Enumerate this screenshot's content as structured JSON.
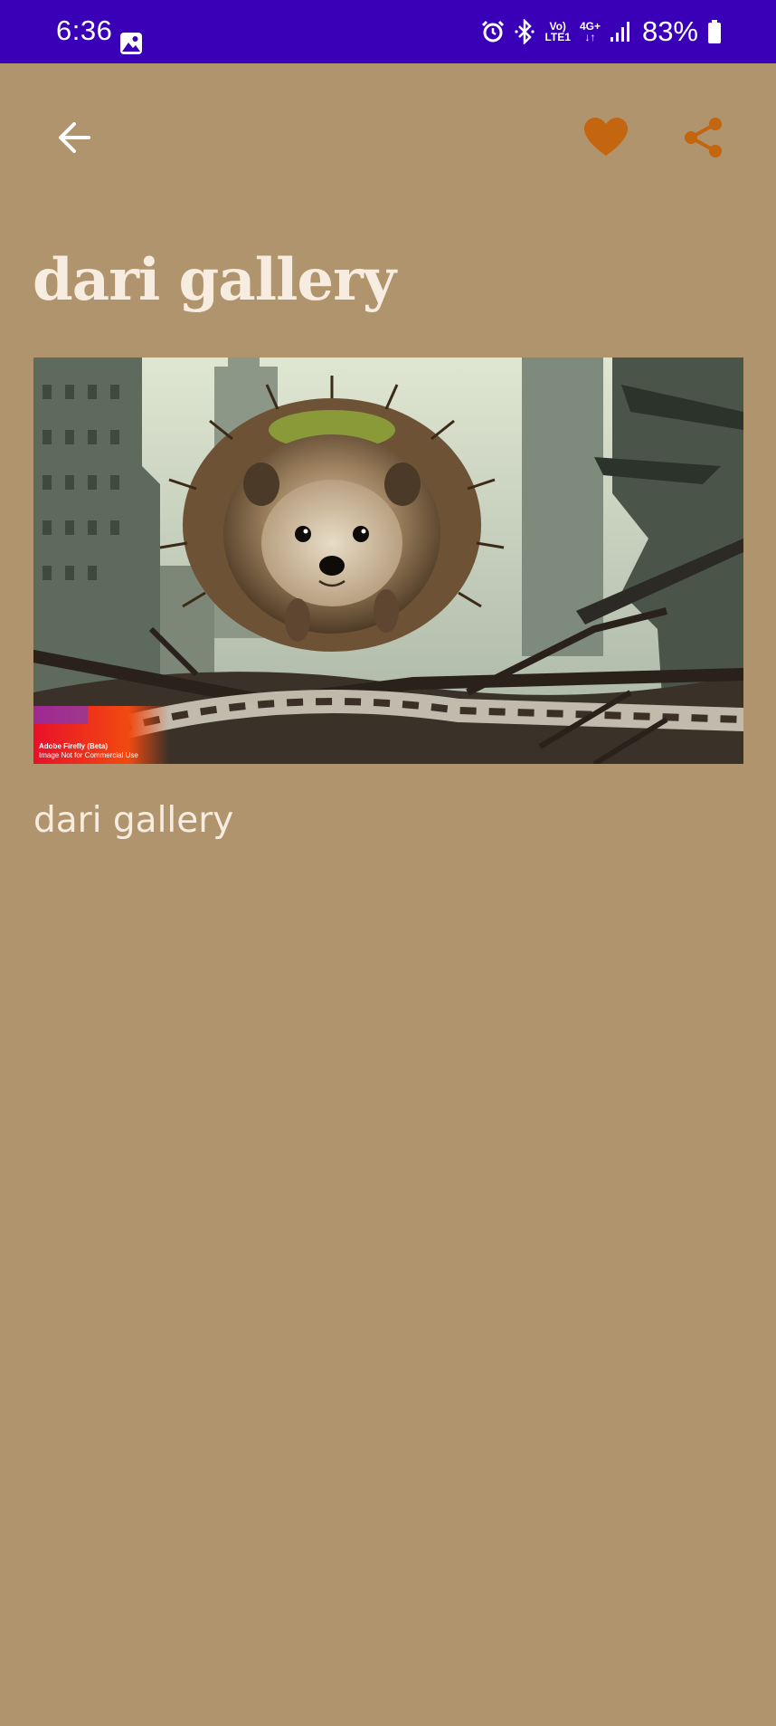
{
  "status_bar": {
    "time": "6:36",
    "network_top": "Vo)",
    "network_bottom": "LTE1",
    "data_type": "4G+",
    "battery_percent": "83%"
  },
  "app_bar": {
    "back_icon": "arrow-left-icon",
    "favorite_icon": "heart-icon",
    "share_icon": "share-icon",
    "accent_color": "#c4650f"
  },
  "page": {
    "title": "dari gallery",
    "caption": "dari gallery",
    "background_color": "#b0946d"
  },
  "image": {
    "watermark_brand": "Adobe Firefly (Beta)",
    "watermark_note": "Image Not for Commercial Use"
  }
}
